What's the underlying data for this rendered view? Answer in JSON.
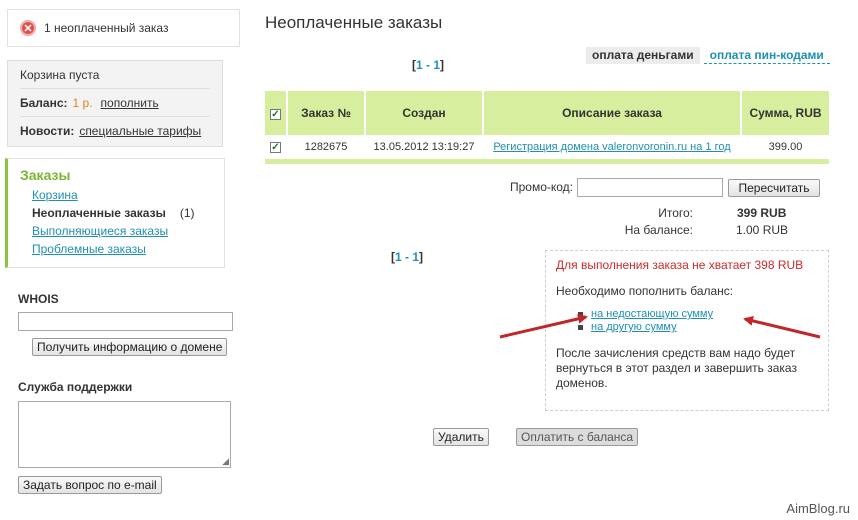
{
  "alert": {
    "text": "1 неоплаченный заказ",
    "icon": "error-icon"
  },
  "cart": {
    "empty_text": "Корзина пуста",
    "balance_label": "Баланс:",
    "balance_value": "1 р.",
    "topup_link": "пополнить",
    "news_label": "Новости:",
    "news_link": "специальные тарифы"
  },
  "orders_menu": {
    "title": "Заказы",
    "items": [
      {
        "label": "Корзина"
      },
      {
        "label": "Неоплаченные заказы",
        "count": "(1)"
      },
      {
        "label": "Выполняющиеся заказы"
      },
      {
        "label": "Проблемные заказы"
      }
    ]
  },
  "whois": {
    "title": "WHOIS",
    "input_value": "",
    "button": "Получить информацию о домене"
  },
  "support": {
    "title": "Служба поддержки",
    "textarea_value": "",
    "button": "Задать вопрос по e-mail"
  },
  "main": {
    "title": "Неоплаченные заказы",
    "pager_top": {
      "open": "[",
      "range": "1 - 1",
      "close": "]"
    },
    "pager_bottom": {
      "open": "[",
      "range": "1 - 1",
      "close": "]"
    },
    "pay_tabs": [
      "оплата деньгами",
      "оплата пин-кодами"
    ],
    "table": {
      "headers": [
        "Заказ №",
        "Создан",
        "Описание заказа",
        "Сумма, RUB"
      ],
      "rows": [
        {
          "checked": true,
          "order_no": "1282675",
          "created": "13.05.2012 13:19:27",
          "description": "Регистрация домена valeronvoronin.ru на 1 год",
          "sum": "399.00"
        }
      ]
    },
    "promo_label": "Промо-код:",
    "promo_value": "",
    "recalc_button": "Пересчитать",
    "total_label": "Итого:",
    "total_value": "399 RUB",
    "on_balance_label": "На балансе:",
    "on_balance_value": "1.00 RUB",
    "notice": {
      "warning": "Для выполнения заказа не хватает 398 RUB",
      "need_topup": "Необходимо пополнить баланс:",
      "link_shortfall": "на недостающую сумму",
      "link_other": "на другую сумму",
      "after": "После зачисления средств вам надо будет вернуться в этот раздел и завершить заказ доменов."
    },
    "delete_button": "Удалить",
    "pay_button": "Оплатить с баланса"
  },
  "watermark": "AimBlog.ru",
  "colors": {
    "accent_green": "#8ac43f",
    "table_header": "#d7ee9f",
    "link": "#1f8fb3",
    "warning": "#cc2a2a",
    "arrow": "#c0262a"
  }
}
